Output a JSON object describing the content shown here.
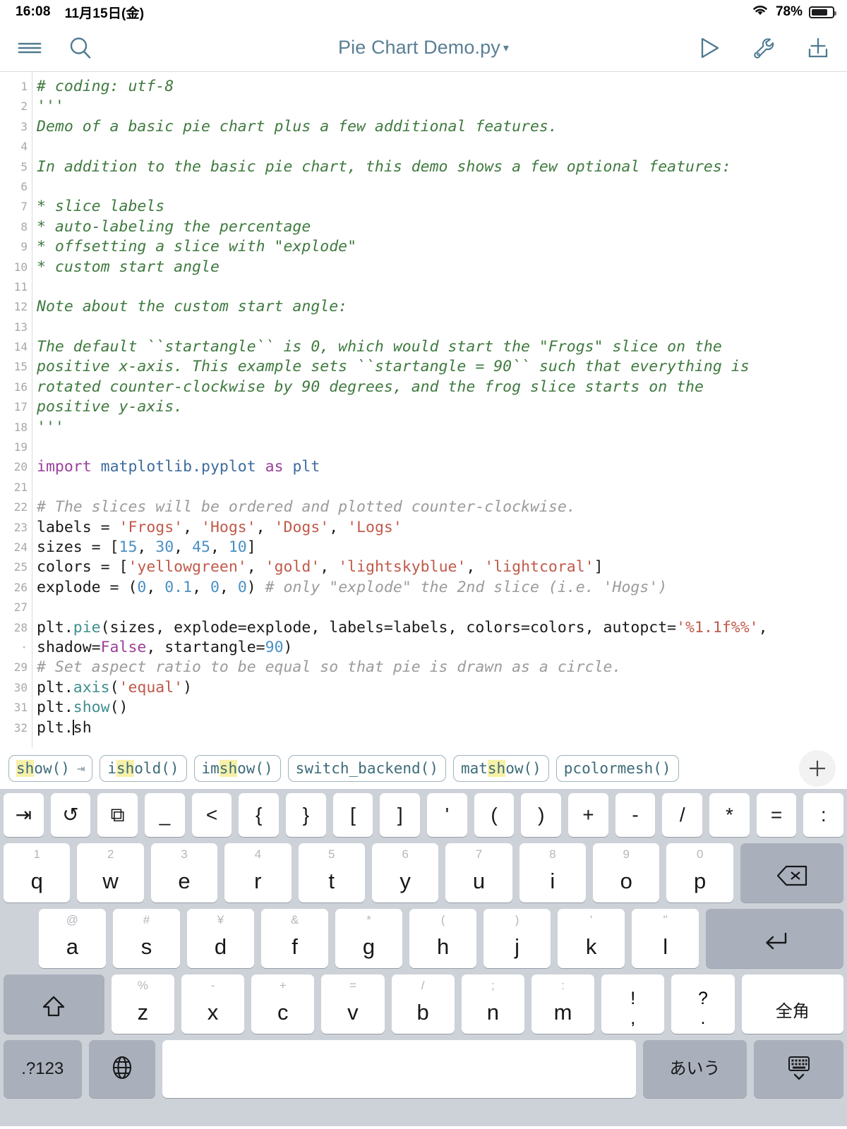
{
  "statusbar": {
    "time": "16:08",
    "date": "11月15日(金)",
    "battery_pct": "78%",
    "wifi_icon": "wifi-icon",
    "battery_icon": "battery-icon"
  },
  "toolbar": {
    "menu_icon": "hamburger-menu-icon",
    "search_icon": "search-icon",
    "title": "Pie Chart Demo.py",
    "title_caret": "▾",
    "run_icon": "run-play-icon",
    "wrench_icon": "wrench-icon",
    "share_icon": "add-to-tray-icon"
  },
  "editor": {
    "lines": [
      {
        "no": "1",
        "segments": [
          {
            "t": "# coding: utf-8",
            "c": "cmt"
          }
        ]
      },
      {
        "no": "2",
        "segments": [
          {
            "t": "'''",
            "c": "cmt"
          }
        ]
      },
      {
        "no": "3",
        "segments": [
          {
            "t": "Demo of a basic pie chart plus a few additional features.",
            "c": "cmt"
          }
        ]
      },
      {
        "no": "4",
        "segments": []
      },
      {
        "no": "5",
        "segments": [
          {
            "t": "In addition to the basic pie chart, this demo shows a few optional features:",
            "c": "cmt"
          }
        ]
      },
      {
        "no": "6",
        "segments": []
      },
      {
        "no": "7",
        "segments": [
          {
            "t": "* slice labels",
            "c": "cmt"
          }
        ]
      },
      {
        "no": "8",
        "segments": [
          {
            "t": "* auto-labeling the percentage",
            "c": "cmt"
          }
        ]
      },
      {
        "no": "9",
        "segments": [
          {
            "t": "* offsetting a slice with \"explode\"",
            "c": "cmt"
          }
        ]
      },
      {
        "no": "10",
        "segments": [
          {
            "t": "* custom start angle",
            "c": "cmt"
          }
        ]
      },
      {
        "no": "11",
        "segments": []
      },
      {
        "no": "12",
        "segments": [
          {
            "t": "Note about the custom start angle:",
            "c": "cmt"
          }
        ]
      },
      {
        "no": "13",
        "segments": []
      },
      {
        "no": "14",
        "segments": [
          {
            "t": "The default ``startangle`` is 0, which would start the \"Frogs\" slice on the",
            "c": "cmt"
          }
        ]
      },
      {
        "no": "15",
        "segments": [
          {
            "t": "positive x-axis. This example sets ``startangle = 90`` such that everything is",
            "c": "cmt"
          }
        ]
      },
      {
        "no": "16",
        "segments": [
          {
            "t": "rotated counter-clockwise by 90 degrees, and the frog slice starts on the",
            "c": "cmt"
          }
        ]
      },
      {
        "no": "17",
        "segments": [
          {
            "t": "positive y-axis.",
            "c": "cmt"
          }
        ]
      },
      {
        "no": "18",
        "segments": [
          {
            "t": "'''",
            "c": "cmt"
          }
        ]
      },
      {
        "no": "19",
        "segments": []
      },
      {
        "no": "20",
        "segments": [
          {
            "t": "import",
            "c": "kw"
          },
          {
            "t": " ",
            "c": "pl"
          },
          {
            "t": "matplotlib.pyplot",
            "c": "mod"
          },
          {
            "t": " ",
            "c": "pl"
          },
          {
            "t": "as",
            "c": "kw"
          },
          {
            "t": " ",
            "c": "pl"
          },
          {
            "t": "plt",
            "c": "mod"
          }
        ]
      },
      {
        "no": "21",
        "segments": []
      },
      {
        "no": "22",
        "segments": [
          {
            "t": "# The slices will be ordered and plotted counter-clockwise.",
            "c": "cmt-gray"
          }
        ]
      },
      {
        "no": "23",
        "segments": [
          {
            "t": "labels = ",
            "c": "pl"
          },
          {
            "t": "'Frogs'",
            "c": "str"
          },
          {
            "t": ", ",
            "c": "pl"
          },
          {
            "t": "'Hogs'",
            "c": "str"
          },
          {
            "t": ", ",
            "c": "pl"
          },
          {
            "t": "'Dogs'",
            "c": "str"
          },
          {
            "t": ", ",
            "c": "pl"
          },
          {
            "t": "'Logs'",
            "c": "str"
          }
        ]
      },
      {
        "no": "24",
        "segments": [
          {
            "t": "sizes = [",
            "c": "pl"
          },
          {
            "t": "15",
            "c": "num"
          },
          {
            "t": ", ",
            "c": "pl"
          },
          {
            "t": "30",
            "c": "num"
          },
          {
            "t": ", ",
            "c": "pl"
          },
          {
            "t": "45",
            "c": "num"
          },
          {
            "t": ", ",
            "c": "pl"
          },
          {
            "t": "10",
            "c": "num"
          },
          {
            "t": "]",
            "c": "pl"
          }
        ]
      },
      {
        "no": "25",
        "segments": [
          {
            "t": "colors = [",
            "c": "pl"
          },
          {
            "t": "'yellowgreen'",
            "c": "str"
          },
          {
            "t": ", ",
            "c": "pl"
          },
          {
            "t": "'gold'",
            "c": "str"
          },
          {
            "t": ", ",
            "c": "pl"
          },
          {
            "t": "'lightskyblue'",
            "c": "str"
          },
          {
            "t": ", ",
            "c": "pl"
          },
          {
            "t": "'lightcoral'",
            "c": "str"
          },
          {
            "t": "]",
            "c": "pl"
          }
        ]
      },
      {
        "no": "26",
        "segments": [
          {
            "t": "explode = (",
            "c": "pl"
          },
          {
            "t": "0",
            "c": "num"
          },
          {
            "t": ", ",
            "c": "pl"
          },
          {
            "t": "0.1",
            "c": "num"
          },
          {
            "t": ", ",
            "c": "pl"
          },
          {
            "t": "0",
            "c": "num"
          },
          {
            "t": ", ",
            "c": "pl"
          },
          {
            "t": "0",
            "c": "num"
          },
          {
            "t": ") ",
            "c": "pl"
          },
          {
            "t": "# only \"explode\" the 2nd slice (i.e. 'Hogs')",
            "c": "cmt-gray"
          }
        ]
      },
      {
        "no": "27",
        "segments": []
      },
      {
        "no": "28",
        "segments": [
          {
            "t": "plt.",
            "c": "pl"
          },
          {
            "t": "pie",
            "c": "fn"
          },
          {
            "t": "(sizes, explode=explode, labels=labels, colors=colors, autopct=",
            "c": "pl"
          },
          {
            "t": "'%1.1f%%'",
            "c": "str"
          },
          {
            "t": ",",
            "c": "pl"
          }
        ]
      },
      {
        "no": "·",
        "segments": [
          {
            "t": "shadow=",
            "c": "pl"
          },
          {
            "t": "False",
            "c": "kw"
          },
          {
            "t": ", startangle=",
            "c": "pl"
          },
          {
            "t": "90",
            "c": "num"
          },
          {
            "t": ")",
            "c": "pl"
          }
        ]
      },
      {
        "no": "29",
        "segments": [
          {
            "t": "# Set aspect ratio to be equal so that pie is drawn as a circle.",
            "c": "cmt-gray"
          }
        ]
      },
      {
        "no": "30",
        "segments": [
          {
            "t": "plt.",
            "c": "pl"
          },
          {
            "t": "axis",
            "c": "fn"
          },
          {
            "t": "(",
            "c": "pl"
          },
          {
            "t": "'equal'",
            "c": "str"
          },
          {
            "t": ")",
            "c": "pl"
          }
        ]
      },
      {
        "no": "31",
        "segments": [
          {
            "t": "plt.",
            "c": "pl"
          },
          {
            "t": "show",
            "c": "fn"
          },
          {
            "t": "()",
            "c": "pl"
          }
        ]
      },
      {
        "no": "32",
        "segments": [
          {
            "t": "plt.",
            "c": "pl"
          },
          {
            "t": "",
            "c": "caret"
          },
          {
            "t": "sh",
            "c": "pl"
          }
        ]
      }
    ]
  },
  "suggestions": {
    "items": [
      {
        "prefix": "",
        "hl": "sh",
        "suffix": "ow()",
        "tab": "⇥"
      },
      {
        "prefix": "i",
        "hl": "sh",
        "suffix": "old()",
        "tab": ""
      },
      {
        "prefix": "im",
        "hl": "sh",
        "suffix": "ow()",
        "tab": ""
      },
      {
        "prefix": "switch_backend()",
        "hl": "",
        "suffix": "",
        "tab": ""
      },
      {
        "prefix": "mat",
        "hl": "sh",
        "suffix": "ow()",
        "tab": ""
      },
      {
        "prefix": "pcolormesh()",
        "hl": "",
        "suffix": "",
        "tab": ""
      }
    ],
    "add_icon": "plus-icon"
  },
  "keyboard": {
    "symbol_row": [
      {
        "name": "tab-key",
        "glyph": "⇥"
      },
      {
        "name": "undo-key",
        "glyph": "↺"
      },
      {
        "name": "copy-paste-key",
        "glyph": "⧉"
      },
      {
        "name": "underscore-key",
        "glyph": "_"
      },
      {
        "name": "less-than-key",
        "glyph": "<"
      },
      {
        "name": "brace-open-key",
        "glyph": "{"
      },
      {
        "name": "brace-close-key",
        "glyph": "}"
      },
      {
        "name": "bracket-open-key",
        "glyph": "["
      },
      {
        "name": "bracket-close-key",
        "glyph": "]"
      },
      {
        "name": "apostrophe-key",
        "glyph": "'"
      },
      {
        "name": "paren-open-key",
        "glyph": "("
      },
      {
        "name": "paren-close-key",
        "glyph": ")"
      },
      {
        "name": "plus-key",
        "glyph": "+"
      },
      {
        "name": "minus-key",
        "glyph": "-"
      },
      {
        "name": "slash-key",
        "glyph": "/"
      },
      {
        "name": "asterisk-key",
        "glyph": "*"
      },
      {
        "name": "equals-key",
        "glyph": "="
      },
      {
        "name": "colon-key",
        "glyph": ":"
      }
    ],
    "row1": [
      {
        "hint": "1",
        "main": "q"
      },
      {
        "hint": "2",
        "main": "w"
      },
      {
        "hint": "3",
        "main": "e"
      },
      {
        "hint": "4",
        "main": "r"
      },
      {
        "hint": "5",
        "main": "t"
      },
      {
        "hint": "6",
        "main": "y"
      },
      {
        "hint": "7",
        "main": "u"
      },
      {
        "hint": "8",
        "main": "i"
      },
      {
        "hint": "9",
        "main": "o"
      },
      {
        "hint": "0",
        "main": "p"
      }
    ],
    "backspace": "⌫",
    "row2": [
      {
        "hint": "@",
        "main": "a"
      },
      {
        "hint": "#",
        "main": "s"
      },
      {
        "hint": "¥",
        "main": "d"
      },
      {
        "hint": "&",
        "main": "f"
      },
      {
        "hint": "*",
        "main": "g"
      },
      {
        "hint": "(",
        "main": "h"
      },
      {
        "hint": ")",
        "main": "j"
      },
      {
        "hint": "'",
        "main": "k"
      },
      {
        "hint": "\"",
        "main": "l"
      }
    ],
    "return": "⏎",
    "shift": "⇧",
    "row3": [
      {
        "hint": "%",
        "main": "z"
      },
      {
        "hint": "-",
        "main": "x"
      },
      {
        "hint": "+",
        "main": "c"
      },
      {
        "hint": "=",
        "main": "v"
      },
      {
        "hint": "/",
        "main": "b"
      },
      {
        "hint": ";",
        "main": "n"
      },
      {
        "hint": ":",
        "main": "m"
      }
    ],
    "punct1": {
      "up": "!",
      "dn": ","
    },
    "punct2": {
      "up": "?",
      "dn": "."
    },
    "zenkaku": "全角",
    "numeric": ".?123",
    "globe_icon": "globe-icon",
    "space": "",
    "ime": "あいう",
    "hide_icon": "hide-keyboard-icon"
  }
}
